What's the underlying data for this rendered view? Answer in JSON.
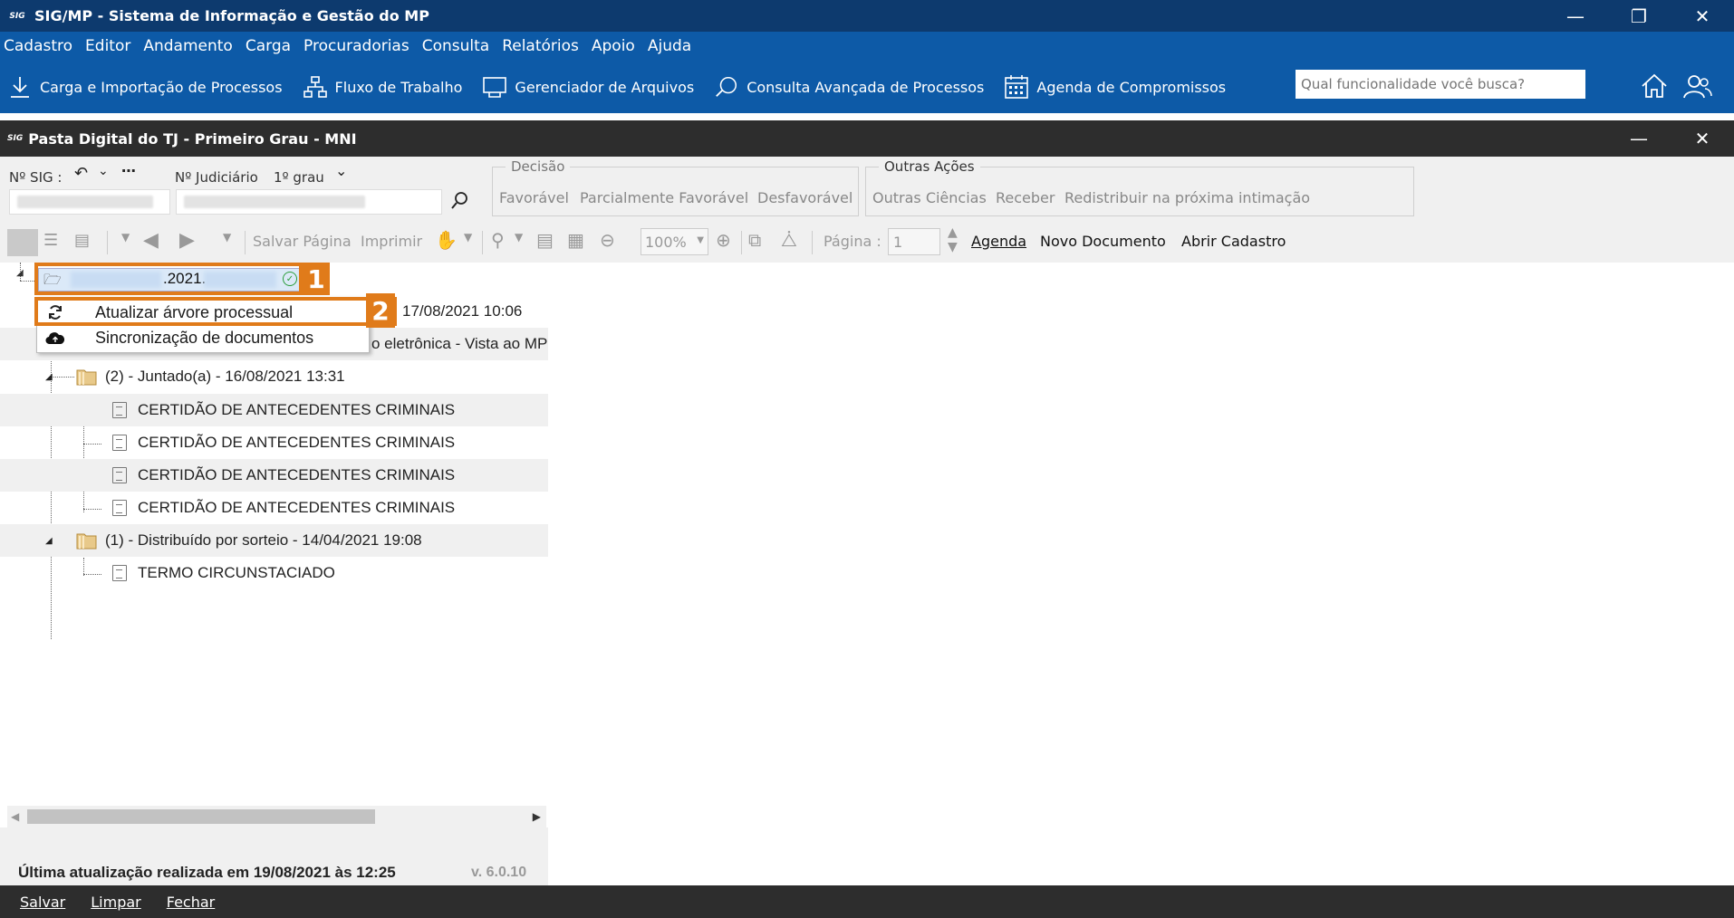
{
  "app": {
    "title": "SIG/MP - Sistema de Informação e Gestão do MP",
    "icon_text": "SIG"
  },
  "menu": [
    "Cadastro",
    "Editor",
    "Andamento",
    "Carga",
    "Procuradorias",
    "Consulta",
    "Relatórios",
    "Apoio",
    "Ajuda"
  ],
  "quickbar": {
    "items": [
      {
        "label": "Carga e Importação de Processos",
        "icon": "download-icon"
      },
      {
        "label": "Fluxo de Trabalho",
        "icon": "workflow-icon"
      },
      {
        "label": "Gerenciador de Arquivos",
        "icon": "file-manager-icon"
      },
      {
        "label": "Consulta Avançada de Processos",
        "icon": "search-advanced-icon"
      },
      {
        "label": "Agenda de Compromissos",
        "icon": "calendar-icon"
      }
    ],
    "search_placeholder": "Qual funcionalidade você busca?"
  },
  "window": {
    "title": "Pasta Digital do TJ - Primeiro Grau - MNI"
  },
  "form": {
    "nsig_label": "Nº SIG :",
    "njud_label": "Nº Judiciário",
    "grau_label": "1º grau",
    "decisao": {
      "legend": "Decisão",
      "items": [
        "Favorável",
        "Parcialmente Favorável",
        "Desfavorável"
      ]
    },
    "outras": {
      "legend": "Outras Ações",
      "items": [
        "Outras Ciências",
        "Receber",
        "Redistribuir na próxima intimação"
      ]
    }
  },
  "toolbar2": {
    "salvar_pagina": "Salvar Página",
    "imprimir": "Imprimir",
    "zoom": "100%",
    "pagina_label": "Página :",
    "pagina_value": "1",
    "agenda": "Agenda",
    "novo_documento": "Novo Documento",
    "abrir_cadastro": "Abrir Cadastro"
  },
  "tree": {
    "root_text": ".2021.",
    "partial_row1": "17/08/2021 10:06",
    "partial_row2": "o eletrônica - Vista ao MP",
    "nodes": [
      {
        "label": "(2) - Juntado(a) - 16/08/2021 13:31",
        "children": [
          "CERTIDÃO DE ANTECEDENTES CRIMINAIS",
          "CERTIDÃO DE ANTECEDENTES CRIMINAIS",
          "CERTIDÃO DE ANTECEDENTES CRIMINAIS",
          "CERTIDÃO DE ANTECEDENTES CRIMINAIS"
        ]
      },
      {
        "label": "(1) - Distribuído por sorteio - 14/04/2021 19:08",
        "children": [
          "TERMO CIRCUNSTACIADO"
        ]
      }
    ]
  },
  "context_menu": [
    {
      "label": "Atualizar árvore processual",
      "icon": "refresh-icon"
    },
    {
      "label": "Sincronização de documentos",
      "icon": "cloud-sync-icon"
    }
  ],
  "callouts": [
    "1",
    "2"
  ],
  "status": {
    "text": "Última atualização realizada em 19/08/2021 às 12:25",
    "version": "v. 6.0.10"
  },
  "bottom": [
    "Salvar",
    "Limpar",
    "Fechar"
  ],
  "colors": {
    "accent": "#e07b1a",
    "titlebar": "#0d3a6e",
    "menubar": "#0d5aa7",
    "darkbar": "#2d2d2d"
  }
}
